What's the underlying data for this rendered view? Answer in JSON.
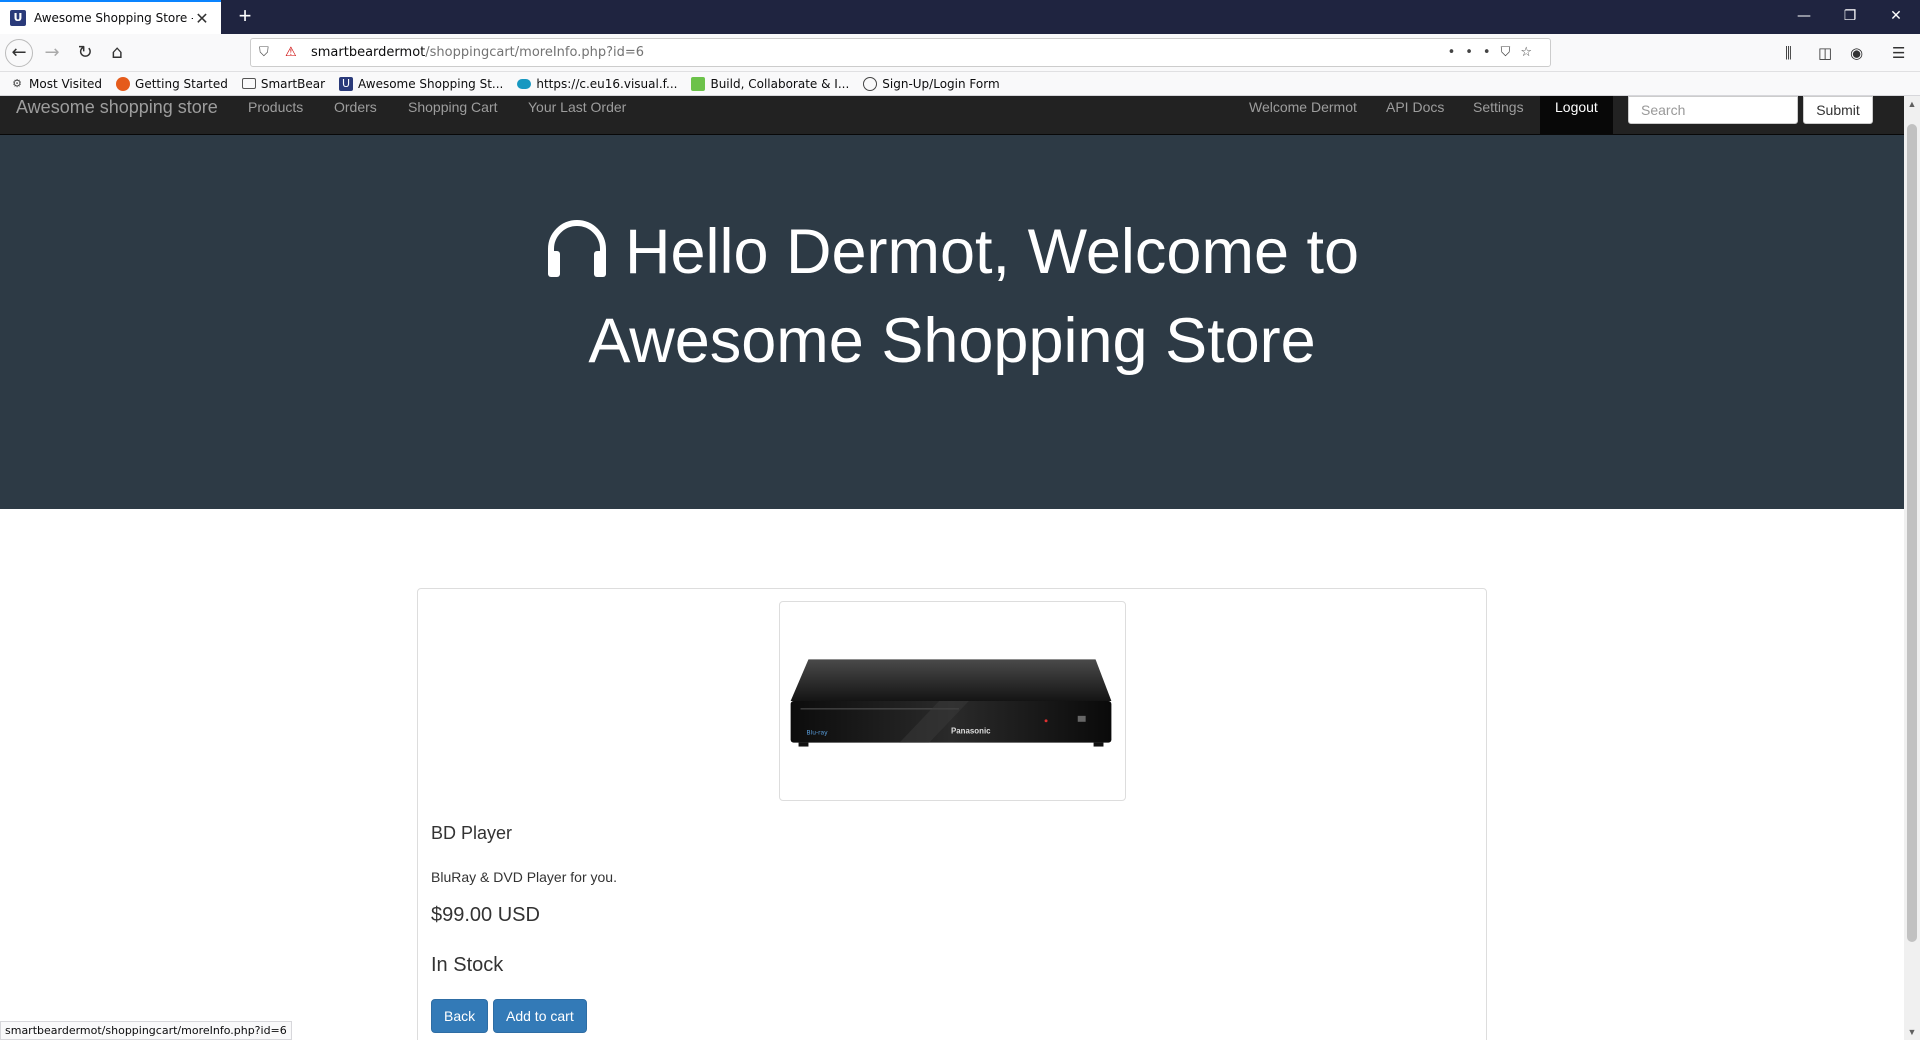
{
  "browser": {
    "tab_title": "Awesome Shopping Store - Pro",
    "url_host": "smartbeardermot",
    "url_path": "/shoppingcart/moreInfo.php?id=6",
    "status_url": "smartbeardermot/shoppingcart/moreInfo.php?id=6",
    "bookmarks": [
      {
        "label": "Most Visited",
        "icon": "gear-icon"
      },
      {
        "label": "Getting Started",
        "icon": "firefox-icon"
      },
      {
        "label": "SmartBear",
        "icon": "folder-icon"
      },
      {
        "label": "Awesome Shopping St...",
        "icon": "store-icon"
      },
      {
        "label": "https://c.eu16.visual.f...",
        "icon": "cloud-icon"
      },
      {
        "label": "Build, Collaborate & I...",
        "icon": "build-icon"
      },
      {
        "label": "Sign-Up/Login Form",
        "icon": "globe-icon"
      }
    ]
  },
  "site": {
    "brand": "Awesome shopping store",
    "nav": [
      "Products",
      "Orders",
      "Shopping Cart",
      "Your Last Order"
    ],
    "welcome": "Welcome Dermot",
    "api_docs": "API Docs",
    "settings": "Settings",
    "logout": "Logout",
    "search_placeholder": "Search",
    "submit": "Submit"
  },
  "hero": {
    "line1": "Hello Dermot, Welcome to",
    "line2": "Awesome Shopping Store",
    "icon": "headphones-icon"
  },
  "product": {
    "name": "BD Player",
    "description": "BluRay & DVD Player for you.",
    "price": "$99.00 USD",
    "stock": "In Stock",
    "brand_mark": "Panasonic",
    "back_label": "Back",
    "add_label": "Add to cart"
  },
  "colors": {
    "hero_bg": "#2d3a45",
    "nav_bg": "#222222",
    "button_primary": "#337ab7"
  }
}
